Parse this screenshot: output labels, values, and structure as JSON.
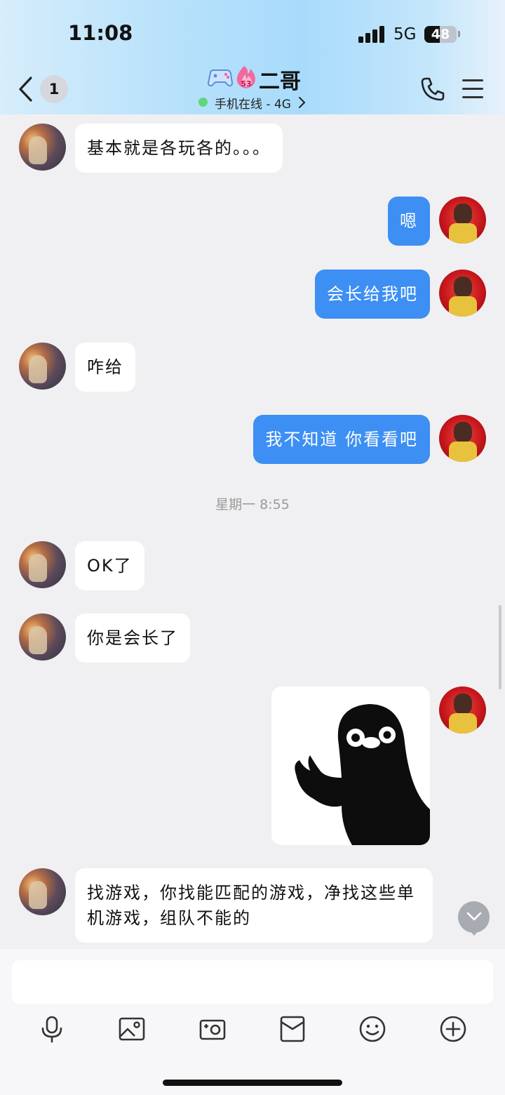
{
  "status": {
    "time": "11:08",
    "network": "5G",
    "battery": "48",
    "battery_level": 0.48
  },
  "header": {
    "back_count": "1",
    "contact_name": "二哥",
    "online_status": "手机在线 - 4G",
    "badge_level": "53",
    "icons": [
      "back-icon",
      "game-controller-icon",
      "flame-badge-icon",
      "phone-icon",
      "menu-icon",
      "chevron-right-icon"
    ]
  },
  "messages": [
    {
      "side": "left",
      "text": "基本就是各玩各的。。。"
    },
    {
      "side": "right",
      "text": "嗯"
    },
    {
      "side": "right",
      "text": "会长给我吧"
    },
    {
      "side": "left",
      "text": "咋给"
    },
    {
      "side": "right",
      "text": "我不知道 你看看吧"
    },
    {
      "side": "left",
      "text": "OK了"
    },
    {
      "side": "left",
      "text": "你是会长了"
    },
    {
      "side": "right",
      "type": "sticker",
      "icon": "penguin-ok-sticker"
    },
    {
      "side": "left",
      "text": "找游戏，你找能匹配的游戏，净找这些单机游戏，组队不能的"
    }
  ],
  "timestamp": "星期一 8:55",
  "input": {
    "placeholder": ""
  },
  "toolbar": [
    "microphone-icon",
    "image-icon",
    "camera-icon",
    "red-packet-icon",
    "emoji-icon",
    "plus-icon"
  ],
  "colors": {
    "sent_bubble": "#3d8ff3",
    "received_bubble": "#ffffff",
    "background": "#f0f0f2"
  }
}
